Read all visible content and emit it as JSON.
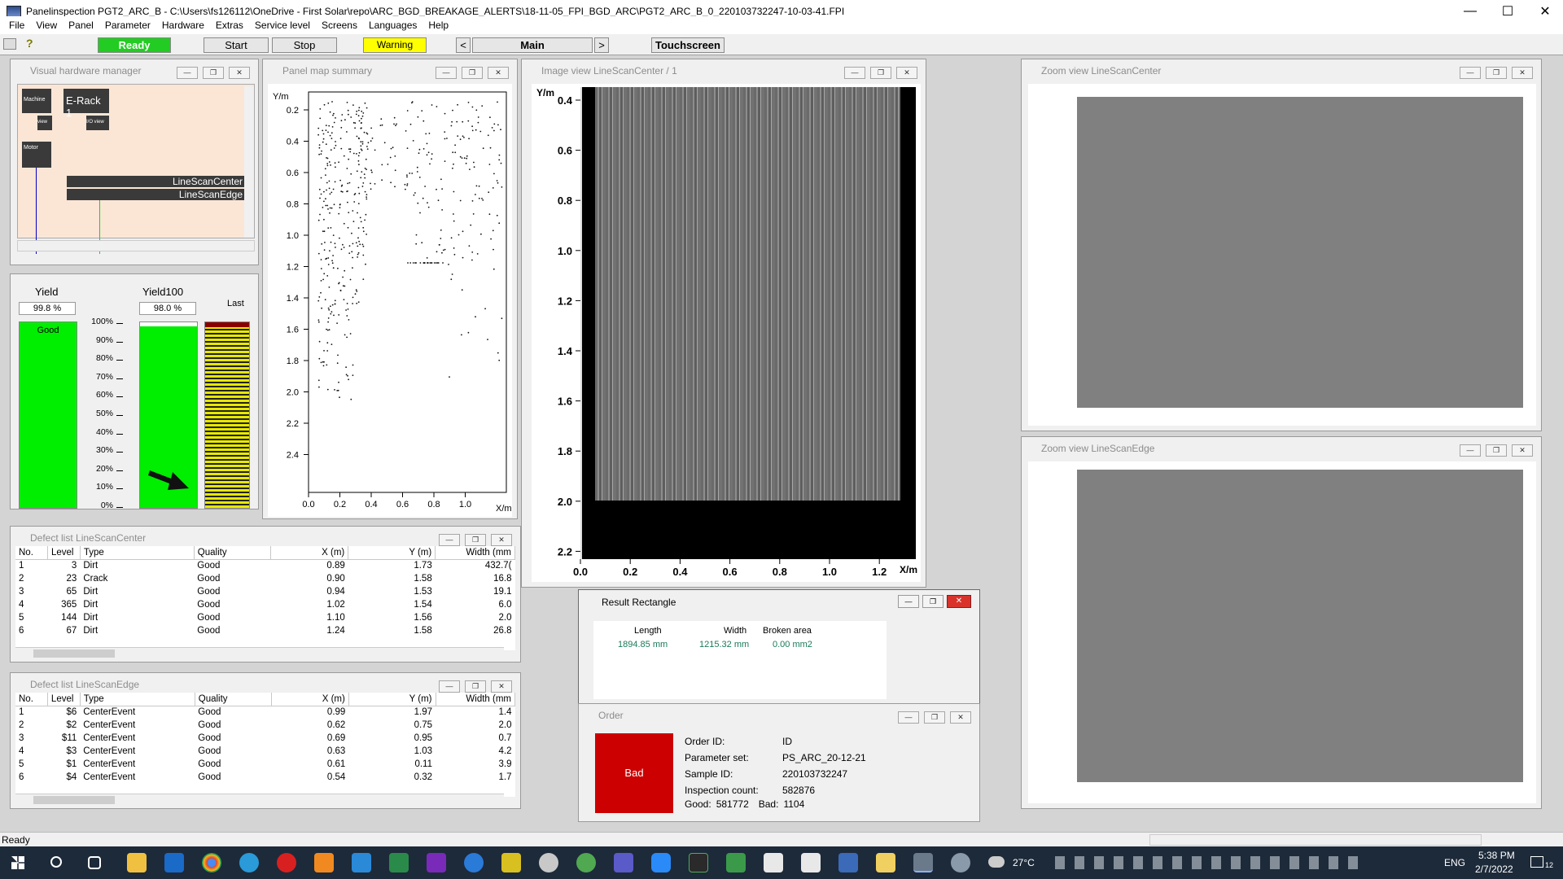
{
  "window": {
    "title": "Panelinspection PGT2_ARC_B - C:\\Users\\fs126112\\OneDrive - First Solar\\repo\\ARC_BGD_BREAKAGE_ALERTS\\18-11-05_FPI_BGD_ARC\\PGT2_ARC_B_0_220103732247-10-03-41.FPI",
    "minimize": "—",
    "maximize": "☐",
    "close": "✕"
  },
  "menu": [
    "File",
    "View",
    "Panel",
    "Parameter",
    "Hardware",
    "Extras",
    "Service level",
    "Screens",
    "Languages",
    "Help"
  ],
  "toolbar": {
    "ready": "Ready",
    "start": "Start",
    "stop": "Stop",
    "warning": "Warning",
    "prev": "<",
    "main": "Main",
    "next": ">",
    "touchscreen": "Touchscreen",
    "colors": {
      "ready": "#22cc22",
      "warning": "#ffff00"
    }
  },
  "hw_manager": {
    "title": "Visual hardware manager",
    "machine": "Machine",
    "view": "view",
    "erack": "E-Rack 1",
    "io_view": "I/O view",
    "motor": "Motor",
    "lsc": "LineScanCenter",
    "lse": "LineScanEdge"
  },
  "yield": {
    "yield_label": "Yield",
    "yield_value": "99.8 %",
    "yield100_label": "Yield100",
    "yield100_value": "98.0 %",
    "last_label": "Last",
    "good": "Good",
    "yield_fill": 0.998,
    "yield100_fill": 0.98,
    "scale": [
      "100%",
      "90%",
      "80%",
      "70%",
      "60%",
      "50%",
      "40%",
      "30%",
      "20%",
      "10%",
      "0%"
    ]
  },
  "panel_map": {
    "title": "Panel map summary",
    "ylabel": "Y/m",
    "xlabel": "X/m",
    "yticks": [
      "0.2",
      "0.4",
      "0.6",
      "0.8",
      "1.0",
      "1.2",
      "1.4",
      "1.6",
      "1.8",
      "2.0",
      "2.2",
      "2.4"
    ],
    "xticks": [
      "0.0",
      "0.2",
      "0.4",
      "0.6",
      "0.8",
      "1.0"
    ]
  },
  "image_view": {
    "title": "Image view LineScanCenter / 1",
    "ylabel": "Y/m",
    "xlabel": "X/m",
    "yticks": [
      "0.4",
      "0.6",
      "0.8",
      "1.0",
      "1.2",
      "1.4",
      "1.6",
      "1.8",
      "2.0",
      "2.2"
    ],
    "xticks": [
      "0.0",
      "0.2",
      "0.4",
      "0.6",
      "0.8",
      "1.0",
      "1.2"
    ]
  },
  "zoom_center": {
    "title": "Zoom view LineScanCenter"
  },
  "zoom_edge": {
    "title": "Zoom view LineScanEdge"
  },
  "defect_center": {
    "title": "Defect list LineScanCenter",
    "headers": [
      "No.",
      "Level",
      "Type",
      "Quality",
      "X (m)",
      "Y (m)",
      "Width (mm"
    ],
    "rows": [
      [
        "1",
        "3",
        "Dirt",
        "Good",
        "0.89",
        "1.73",
        "432.7("
      ],
      [
        "2",
        "23",
        "Crack",
        "Good",
        "0.90",
        "1.58",
        "16.8"
      ],
      [
        "3",
        "65",
        "Dirt",
        "Good",
        "0.94",
        "1.53",
        "19.1"
      ],
      [
        "4",
        "365",
        "Dirt",
        "Good",
        "1.02",
        "1.54",
        "6.0"
      ],
      [
        "5",
        "144",
        "Dirt",
        "Good",
        "1.10",
        "1.56",
        "2.0"
      ],
      [
        "6",
        "67",
        "Dirt",
        "Good",
        "1.24",
        "1.58",
        "26.8"
      ]
    ]
  },
  "defect_edge": {
    "title": "Defect list LineScanEdge",
    "headers": [
      "No.",
      "Level",
      "Type",
      "Quality",
      "X (m)",
      "Y (m)",
      "Width (mm"
    ],
    "rows": [
      [
        "1",
        "$6",
        "CenterEvent",
        "Good",
        "0.99",
        "1.97",
        "1.4"
      ],
      [
        "2",
        "$2",
        "CenterEvent",
        "Good",
        "0.62",
        "0.75",
        "2.0"
      ],
      [
        "3",
        "$11",
        "CenterEvent",
        "Good",
        "0.69",
        "0.95",
        "0.7"
      ],
      [
        "4",
        "$3",
        "CenterEvent",
        "Good",
        "0.63",
        "1.03",
        "4.2"
      ],
      [
        "5",
        "$1",
        "CenterEvent",
        "Good",
        "0.61",
        "0.11",
        "3.9"
      ],
      [
        "6",
        "$4",
        "CenterEvent",
        "Good",
        "0.54",
        "0.32",
        "1.7"
      ]
    ]
  },
  "result_rect": {
    "title": "Result Rectangle",
    "length_label": "Length",
    "width_label": "Width",
    "broken_label": "Broken area",
    "length_value": "1894.85 mm",
    "width_value": "1215.32 mm",
    "broken_value": "0.00 mm2"
  },
  "order": {
    "title": "Order",
    "status": "Bad",
    "status_color": "#cc0000",
    "order_id_label": "Order ID:",
    "order_id_value": "ID",
    "param_label": "Parameter set:",
    "param_value": "PS_ARC_20-12-21",
    "sample_label": "Sample ID:",
    "sample_value": "220103732247",
    "count_label": "Inspection count:",
    "count_value": "582876",
    "good_label": "Good:",
    "good_value": "581772",
    "bad_label": "Bad:",
    "bad_value": "1104"
  },
  "statusbar": {
    "text": "Ready"
  },
  "taskbar": {
    "weather": "27°C",
    "lang": "ENG",
    "time": "5:38 PM",
    "date": "2/7/2022",
    "notif": "12"
  }
}
